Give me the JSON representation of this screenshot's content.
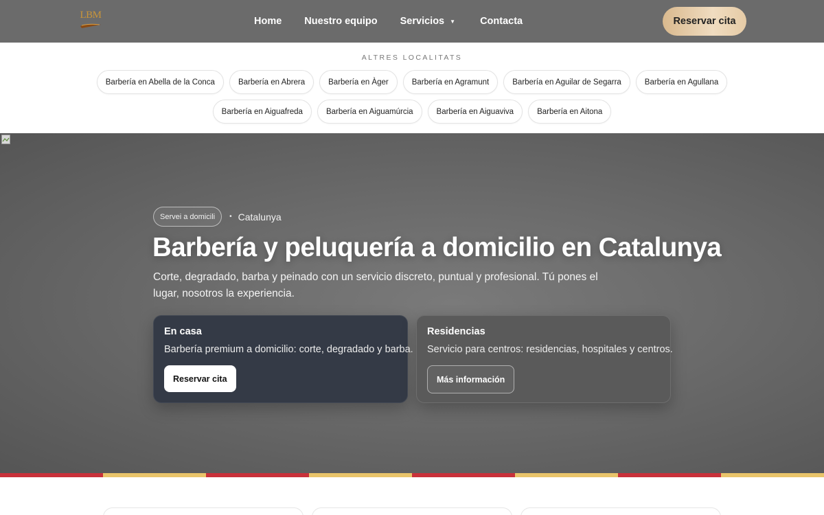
{
  "header": {
    "logo_text": "LBM",
    "nav": [
      {
        "label": "Home"
      },
      {
        "label": "Nuestro equipo"
      },
      {
        "label": "Servicios"
      },
      {
        "label": "Contacta"
      }
    ],
    "cta_label": "Reservar cita",
    "caret_icon": "caret-down-icon"
  },
  "localities": {
    "title": "ALTRES LOCALITATS",
    "row1": [
      "Barbería en Abella de la Conca",
      "Barbería en Abrera",
      "Barbería en Àger",
      "Barbería en Agramunt",
      "Barbería en Aguilar de Segarra",
      "Barbería en Agullana"
    ],
    "row2": [
      "Barbería en Aiguafreda",
      "Barbería en Aiguamúrcia",
      "Barbería en Aiguaviva",
      "Barbería en Aitona"
    ]
  },
  "hero": {
    "badge": "Servei a domicili",
    "separator": "•",
    "region": "Catalunya",
    "title": "Barbería y peluquería a domicilio en Catalunya",
    "subtitle": "Corte, degradado, barba y peinado con un servicio discreto, puntual y profesional. Tú pones el lugar, nosotros la experiencia.",
    "cards": [
      {
        "title": "En casa",
        "text": "Barbería premium a domicilio: corte, degradado y barba.",
        "button": "Reservar cita"
      },
      {
        "title": "Residencias",
        "text": "Servicio para centros: residencias, hospitales y centros.",
        "button": "Más información"
      }
    ]
  },
  "colors": {
    "header_bg": "#6b6b6b",
    "cta_gold": "#e6cba6",
    "stripe_red": "#c8313a",
    "stripe_yellow": "#e9c46a",
    "card_dark": "#343a46"
  },
  "stripe_pattern": [
    "red",
    "yellow",
    "red",
    "yellow",
    "red",
    "yellow",
    "red",
    "yellow"
  ]
}
